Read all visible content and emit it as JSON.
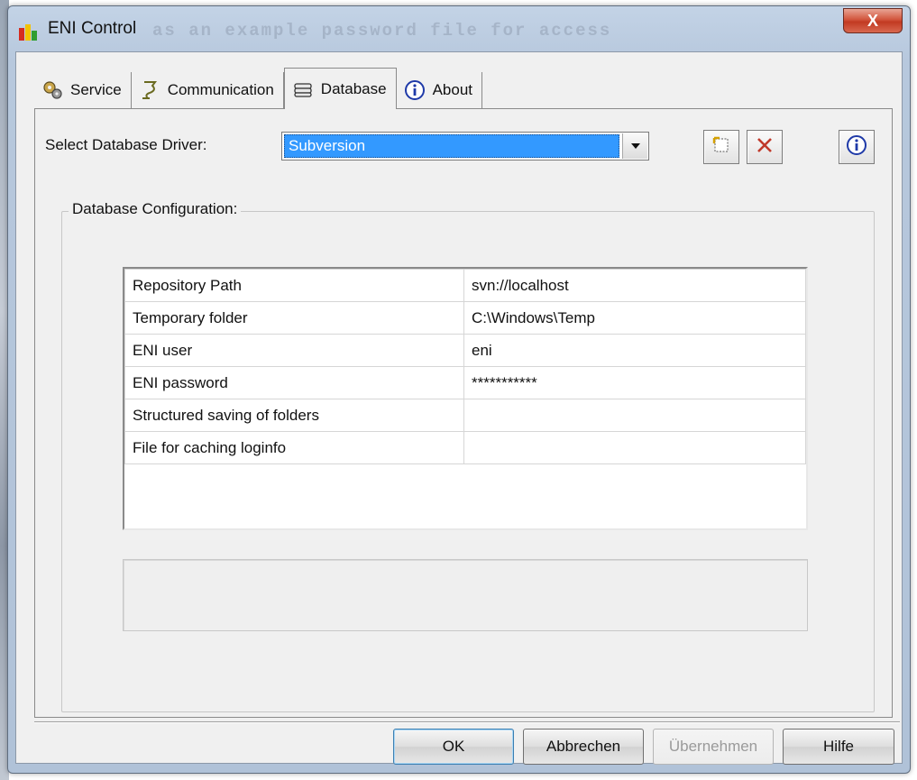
{
  "window": {
    "title": "ENI Control",
    "background_text": "as an example password file for access",
    "close_glyph": "X"
  },
  "tabs": [
    {
      "label": "Service",
      "icon": "gears-icon"
    },
    {
      "label": "Communication",
      "icon": "plug-icon"
    },
    {
      "label": "Database",
      "icon": "database-icon",
      "active": true
    },
    {
      "label": "About",
      "icon": "info-icon"
    }
  ],
  "driver": {
    "label": "Select Database Driver:",
    "value": "Subversion"
  },
  "group": {
    "label": "Database Configuration:"
  },
  "config_rows": [
    {
      "key": "Repository Path",
      "value": "svn://localhost"
    },
    {
      "key": "Temporary folder",
      "value": "C:\\Windows\\Temp"
    },
    {
      "key": "ENI user",
      "value": "eni"
    },
    {
      "key": "ENI password",
      "value": "***********"
    },
    {
      "key": "Structured saving of folders",
      "value": ""
    },
    {
      "key": "File for caching loginfo",
      "value": ""
    }
  ],
  "buttons": {
    "ok": "OK",
    "cancel": "Abbrechen",
    "apply": "Übernehmen",
    "help": "Hilfe"
  },
  "colors": {
    "selection": "#3399ff",
    "delete_x": "#c0392b",
    "titlebar": "#b7c8dd"
  }
}
